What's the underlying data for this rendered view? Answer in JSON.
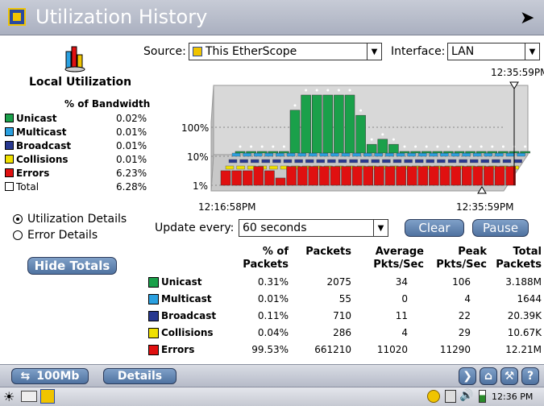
{
  "titlebar": {
    "title": "Utilization History"
  },
  "source": {
    "label": "Source:",
    "value": "This EtherScope"
  },
  "interface": {
    "label": "Interface:",
    "value": "LAN"
  },
  "sidebar": {
    "heading": "Local Utilization",
    "column_header": "% of Bandwidth",
    "legend": [
      {
        "label": "Unicast",
        "value": "0.02%",
        "color": "#1aa04a"
      },
      {
        "label": "Multicast",
        "value": "0.01%",
        "color": "#2aa0e0"
      },
      {
        "label": "Broadcast",
        "value": "0.01%",
        "color": "#283890"
      },
      {
        "label": "Collisions",
        "value": "0.01%",
        "color": "#f0e000"
      },
      {
        "label": "Errors",
        "value": "6.23%",
        "color": "#e01010"
      },
      {
        "label": "Total",
        "value": "6.28%",
        "color": "#ffffff"
      }
    ],
    "radio_utilization": "Utilization Details",
    "radio_error": "Error Details",
    "hide_totals": "Hide Totals"
  },
  "chart_data": {
    "type": "bar",
    "yscale": "log",
    "ytick_labels": [
      "100%",
      "10%",
      "1%"
    ],
    "start_time": "12:16:58PM",
    "end_time": "12:35:59PM",
    "cursor_time": "12:35:59PM",
    "series": [
      {
        "name": "Unicast",
        "values": [
          1,
          1,
          1,
          1,
          1,
          30,
          100,
          100,
          100,
          100,
          100,
          20,
          2,
          3,
          2,
          1,
          1,
          1,
          1,
          1,
          1,
          1,
          1,
          1,
          1,
          1,
          1
        ]
      },
      {
        "name": "Errors",
        "values": [
          4,
          4,
          4,
          6,
          4,
          2,
          6,
          6,
          6,
          6,
          6,
          6,
          6,
          6,
          6,
          6,
          6,
          6,
          6,
          6,
          6,
          6,
          6,
          6,
          6,
          6,
          6
        ]
      }
    ]
  },
  "update": {
    "label": "Update every:",
    "value": "60 seconds",
    "clear": "Clear",
    "pause": "Pause"
  },
  "table": {
    "headers": [
      [
        "% of",
        "Packets"
      ],
      [
        "",
        "Packets"
      ],
      [
        "Average",
        "Pkts/Sec"
      ],
      [
        "Peak",
        "Pkts/Sec"
      ],
      [
        "Total",
        "Packets"
      ]
    ],
    "rows": [
      {
        "label": "Unicast",
        "pct": "0.31%",
        "packets": "2075",
        "avg": "34",
        "peak": "106",
        "total": "3.188M"
      },
      {
        "label": "Multicast",
        "pct": "0.01%",
        "packets": "55",
        "avg": "0",
        "peak": "4",
        "total": "1644"
      },
      {
        "label": "Broadcast",
        "pct": "0.11%",
        "packets": "710",
        "avg": "11",
        "peak": "22",
        "total": "20.39K"
      },
      {
        "label": "Collisions",
        "pct": "0.04%",
        "packets": "286",
        "avg": "4",
        "peak": "29",
        "total": "10.67K"
      },
      {
        "label": "Errors",
        "pct": "99.53%",
        "packets": "661210",
        "avg": "11020",
        "peak": "11290",
        "total": "12.21M"
      }
    ]
  },
  "toolbar": {
    "speed": "100Mb",
    "details": "Details"
  },
  "taskbar": {
    "clock": "12:36 PM"
  }
}
